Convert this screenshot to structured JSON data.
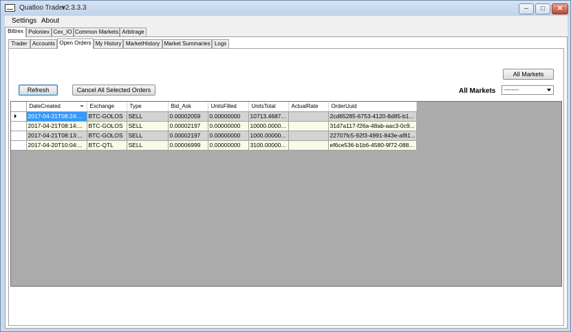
{
  "window": {
    "title": "Quatloo Trader",
    "version": "v2.3.3.3",
    "min": "–",
    "max": "□",
    "close": "✕"
  },
  "menu": [
    "Settings",
    "About"
  ],
  "exchange_tabs": [
    "Bittrex",
    "Poloniex",
    "Cex_IO",
    "Common Markets",
    "Arbitrage"
  ],
  "sub_tabs": [
    "Trader",
    "Accounts",
    "Open Orders",
    "My History",
    "MarketHistory",
    "Market Summaries",
    "Logs"
  ],
  "controls": {
    "refresh": "Refresh",
    "cancel_all": "Cancel All Selected Orders",
    "all_markets_button": "All Markets",
    "all_markets_label": "All Markets",
    "market_select_value": "--------"
  },
  "grid": {
    "columns": [
      "DateCreated",
      "Exchange",
      "Type",
      "Bid_Ask",
      "UnitsFilled",
      "UnitsTotal",
      "ActualRate",
      "OrderUuid"
    ],
    "rows": [
      [
        "2017-04-21T08:24:...",
        "BTC-GOLOS",
        "SELL",
        "0.00002059",
        "0.00000000",
        "10713.4687...",
        "",
        "2cd65285-6753-4120-8d85-b1..."
      ],
      [
        "2017-04-21T08:14:...",
        "BTC-GOLOS",
        "SELL",
        "0.00002197",
        "0.00000000",
        "10000.0000...",
        "",
        "31d7a117-f26a-48ab-aac3-0c9..."
      ],
      [
        "2017-04-21T08:13:...",
        "BTC-GOLOS",
        "SELL",
        "0.00002197",
        "0.00000000",
        "1000.00000...",
        "",
        "22707fc5-92f3-4991-843e-af81..."
      ],
      [
        "2017-04-20T10:04:...",
        "BTC-QTL",
        "SELL",
        "0.00006999",
        "0.00000000",
        "3100.00000...",
        "",
        "ef6ce536-b1b6-4580-9f72-088..."
      ]
    ]
  }
}
